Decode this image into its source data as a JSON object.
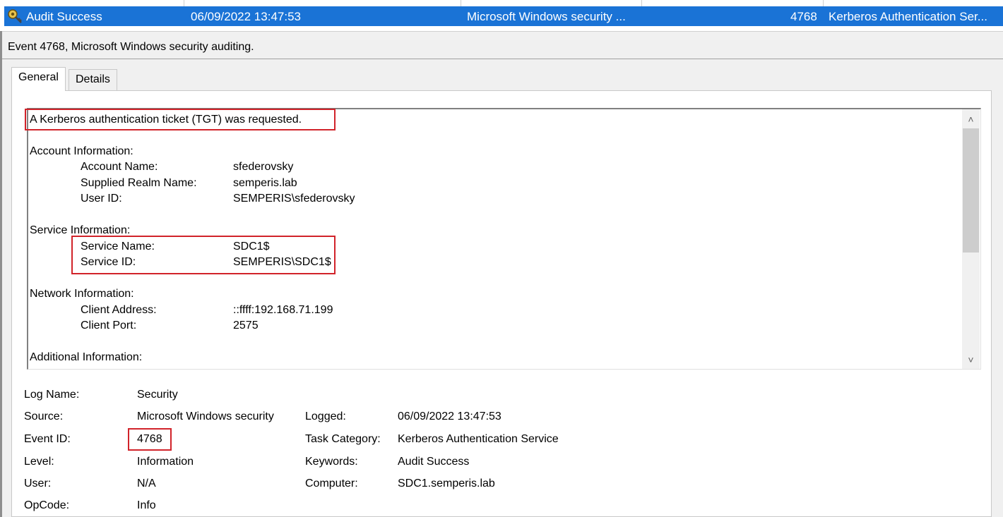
{
  "event_row": {
    "keywords": "Audit Success",
    "date_time": "06/09/2022 13:47:53",
    "source": "Microsoft Windows security ...",
    "event_id": "4768",
    "task_category": "Kerberos Authentication Ser..."
  },
  "pane": {
    "title": "Event 4768, Microsoft Windows security auditing.",
    "tabs": [
      "General",
      "Details"
    ]
  },
  "description": {
    "headline": "A Kerberos authentication ticket (TGT) was requested.",
    "account_header": "Account Information:",
    "account_rows": [
      {
        "label": "Account Name:",
        "value": "sfederovsky"
      },
      {
        "label": "Supplied Realm Name:",
        "value": "semperis.lab"
      },
      {
        "label": "User ID:",
        "value": "SEMPERIS\\sfederovsky"
      }
    ],
    "service_header": "Service Information:",
    "service_rows": [
      {
        "label": "Service Name:",
        "value": "SDC1$"
      },
      {
        "label": "Service ID:",
        "value": "SEMPERIS\\SDC1$"
      }
    ],
    "network_header": "Network Information:",
    "network_rows": [
      {
        "label": "Client Address:",
        "value": "::ffff:192.168.71.199"
      },
      {
        "label": "Client Port:",
        "value": "2575"
      }
    ],
    "additional_header": "Additional Information:"
  },
  "properties": {
    "log_name_label": "Log Name:",
    "log_name": "Security",
    "source_label": "Source:",
    "source": "Microsoft Windows security",
    "event_id_label": "Event ID:",
    "event_id": "4768",
    "level_label": "Level:",
    "level": "Information",
    "user_label": "User:",
    "user": "N/A",
    "opcode_label": "OpCode:",
    "opcode": "Info",
    "logged_label": "Logged:",
    "logged": "06/09/2022 13:47:53",
    "task_category_label": "Task Category:",
    "task_category": "Kerberos Authentication Service",
    "keywords_label": "Keywords:",
    "keywords": "Audit Success",
    "computer_label": "Computer:",
    "computer": "SDC1.semperis.lab"
  },
  "colors": {
    "selection": "#1a73d6",
    "highlight_box": "#d1232a"
  },
  "icons": {
    "event_row": "key-icon",
    "scroll_up": "chevron-up-icon",
    "scroll_down": "chevron-down-icon"
  }
}
